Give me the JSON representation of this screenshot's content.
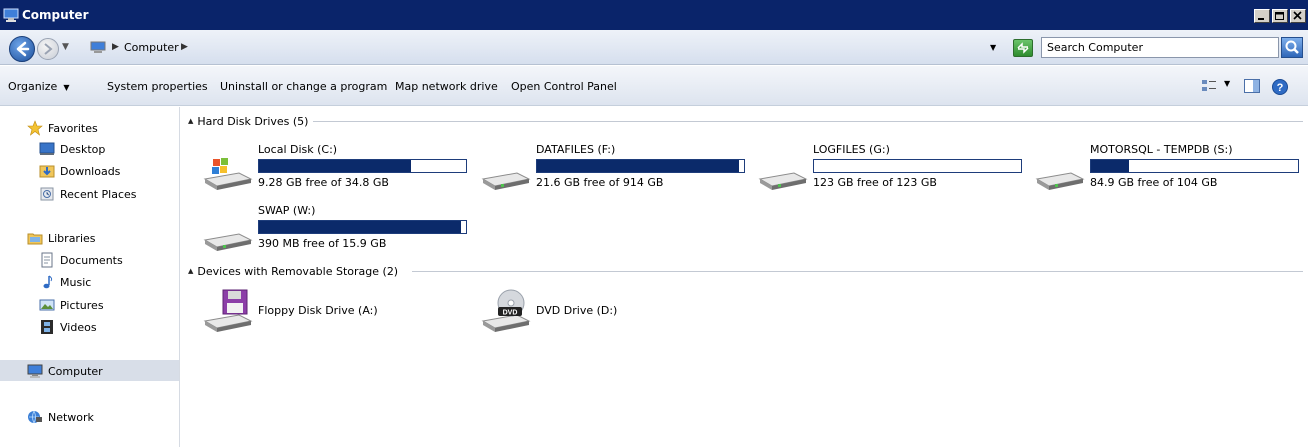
{
  "window": {
    "title": "Computer"
  },
  "address": {
    "crumb": "Computer",
    "search_placeholder": "Search Computer"
  },
  "commands": [
    "Organize",
    "System properties",
    "Uninstall or change a program",
    "Map network drive",
    "Open Control Panel"
  ],
  "nav": {
    "favorites": "Favorites",
    "desktop": "Desktop",
    "downloads": "Downloads",
    "recent": "Recent Places",
    "libraries": "Libraries",
    "documents": "Documents",
    "music": "Music",
    "pictures": "Pictures",
    "videos": "Videos",
    "computer": "Computer",
    "network": "Network"
  },
  "groups": {
    "hdd": "Hard Disk Drives (5)",
    "removable": "Devices with Removable Storage (2)"
  },
  "drives": [
    {
      "name": "Local Disk (C:)",
      "free": "9.28 GB free of 34.8 GB",
      "used_fraction": 0.733
    },
    {
      "name": "DATAFILES (F:)",
      "free": "21.6 GB free of 914 GB",
      "used_fraction": 0.976
    },
    {
      "name": "LOGFILES (G:)",
      "free": "123 GB free of 123 GB",
      "used_fraction": 0.0
    },
    {
      "name": "MOTORSQL - TEMPDB (S:)",
      "free": "84.9 GB free of 104 GB",
      "used_fraction": 0.184
    },
    {
      "name": "SWAP (W:)",
      "free": "390 MB free of 15.9 GB",
      "used_fraction": 0.976
    }
  ],
  "devices": [
    {
      "name": "Floppy Disk Drive (A:)"
    },
    {
      "name": "DVD Drive (D:)"
    }
  ],
  "colors": {
    "titlebar": "#0a246a",
    "bar_fill": "#0b2a6a"
  }
}
